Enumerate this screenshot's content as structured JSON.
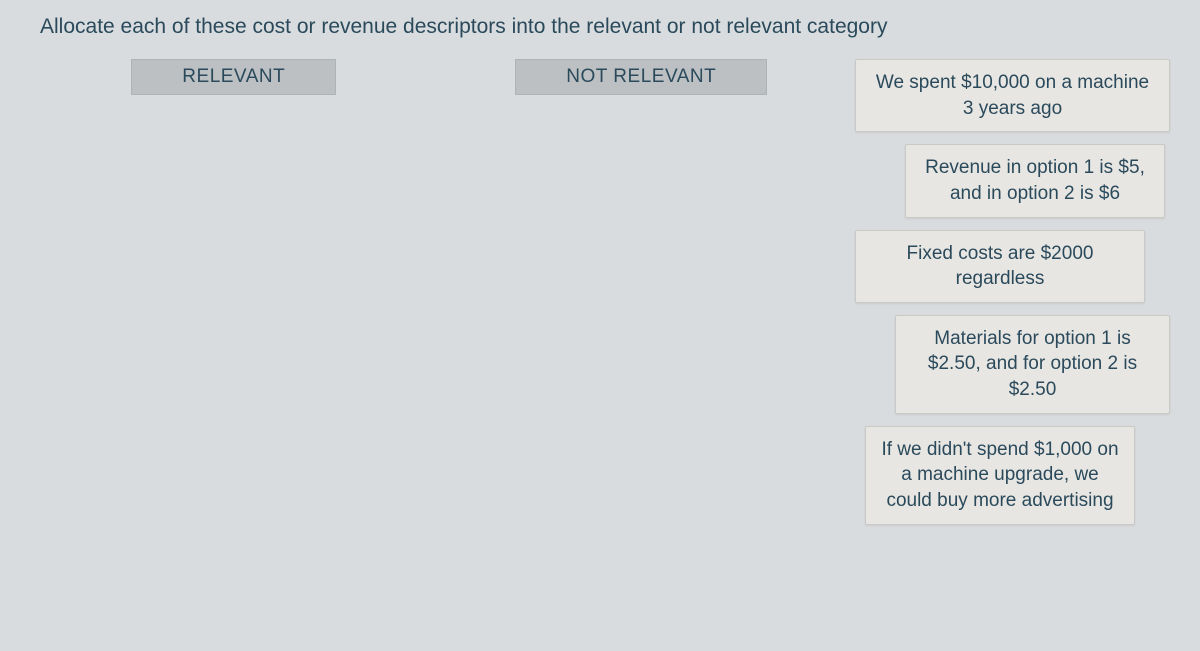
{
  "question": "Allocate each of these cost or revenue descriptors into the relevant or not relevant category",
  "columns": {
    "relevant": "RELEVANT",
    "not_relevant": "NOT RELEVANT"
  },
  "items": [
    "We spent $10,000 on a machine 3 years ago",
    "Revenue in option 1 is $5, and in option 2 is $6",
    "Fixed costs are $2000 regardless",
    "Materials for option 1 is $2.50, and for option 2 is $2.50",
    "If we didn't spend $1,000 on a machine upgrade, we could buy more advertising"
  ]
}
